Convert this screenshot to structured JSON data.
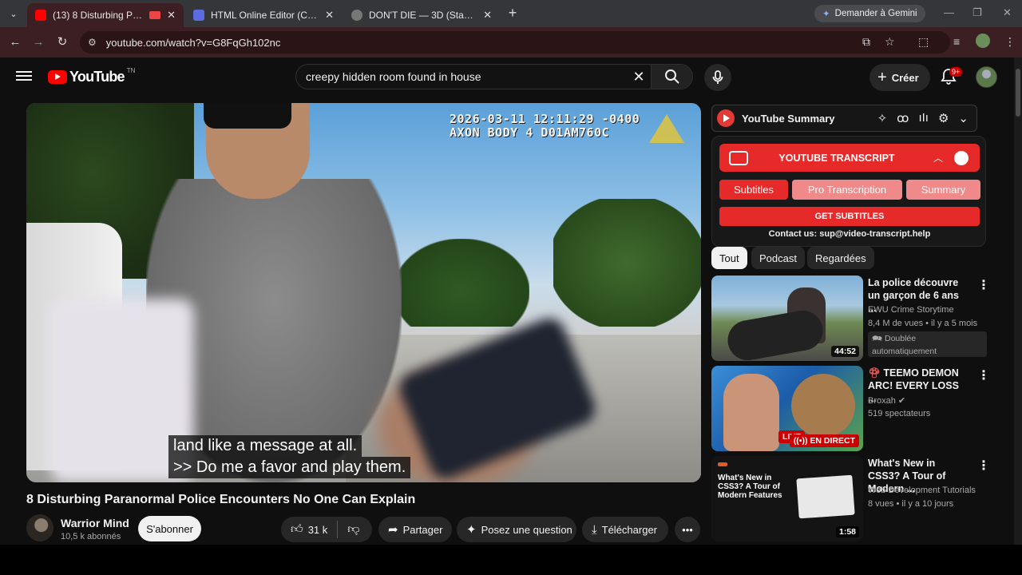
{
  "browser": {
    "tabs": [
      {
        "title": "(13) 8 Disturbing Paranorm",
        "active": true
      },
      {
        "title": "HTML Online Editor (Compiler,",
        "active": false
      },
      {
        "title": "DON'T DIE — 3D (Stage 1)",
        "active": false
      }
    ],
    "gemini_label": "Demander à Gemini",
    "url": "youtube.com/watch?v=G8FqGh102nc"
  },
  "youtube": {
    "logo_text": "YouTube",
    "logo_region": "TN",
    "search_value": "creepy hidden room found in house",
    "create_label": "Créer",
    "notif_count": "9+"
  },
  "video": {
    "overlay_line1": "2026-03-11 12:11:29 -0400",
    "overlay_line2": "AXON BODY 4 D01AM760C",
    "caption_line1": "land like a message at all.",
    "caption_line2": ">> Do me a favor and play them.",
    "title": "8 Disturbing Paranormal Police Encounters No One Can Explain",
    "channel": "Warrior Mind",
    "subscribers": "10,5 k abonnés",
    "subscribe_label": "S'abonner",
    "likes": "31 k",
    "share_label": "Partager",
    "ask_label": "Posez une question",
    "download_label": "Télécharger"
  },
  "extension": {
    "summary_title": "YouTube Summary",
    "transcript_title": "YOUTUBE TRANSCRIPT",
    "tab_subtitles": "Subtitles",
    "tab_pro": "Pro Transcription",
    "tab_summary": "Summary",
    "get_subtitles": "GET SUBTITLES",
    "contact": "Contact us: sup@video-transcript.help"
  },
  "filters": [
    "Tout",
    "Podcast",
    "Regardées"
  ],
  "recommendations": [
    {
      "title": "La police découvre un garçon de 6 ans ...",
      "channel": "EWU Crime Storytime",
      "meta": "8,4 M de vues • il y a 5 mois",
      "extra": "Doublée automatiquement",
      "duration": "44:52"
    },
    {
      "title": "TEEMO DEMON ARC! EVERY LOSS ...",
      "channel": "Broxah",
      "meta": "519 spectateurs",
      "live_label": "EN DIRECT",
      "live_badge": "LIVE"
    },
    {
      "title": "What's New in CSS3? A Tour of Modern ...",
      "channel": "Web Development Tutorials",
      "meta": "8 vues • il y a 10 jours",
      "thumb_text": "What's New in CSS3? A Tour of Modern Features",
      "duration": "1:58"
    }
  ],
  "colors": {
    "accent": "#ff0000",
    "tab_bg": "#3c1f22",
    "ext_red": "#e62a2a",
    "ext_pink": "#f08a8a",
    "page_bg": "#0f0f0f"
  }
}
